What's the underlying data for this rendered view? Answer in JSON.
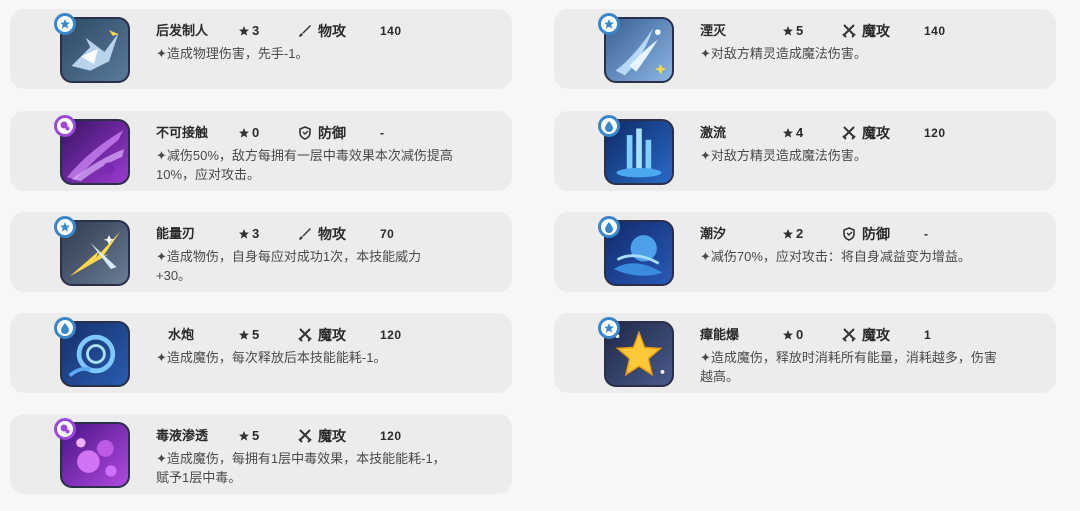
{
  "skills": [
    {
      "name": "后发制人",
      "cost": "3",
      "category": "物攻",
      "power": "140",
      "desc": "✦造成物理伤害，先手-1。",
      "element": "normal",
      "category_icon": "sword-icon",
      "tile_color": "#4a6a88"
    },
    {
      "name": "湮灭",
      "cost": "5",
      "category": "魔攻",
      "power": "140",
      "desc": "✦对敌方精灵造成魔法伤害。",
      "element": "normal",
      "category_icon": "crossed-swords-icon",
      "tile_color": "#5a7fb0"
    },
    {
      "name": "不可接触",
      "cost": "0",
      "category": "防御",
      "power": "-",
      "desc": "✦减伤50%，敌方每拥有一层中毒效果本次减伤提高10%，应对攻击。",
      "element": "poison",
      "category_icon": "shield-icon",
      "tile_color": "#6a2aa0"
    },
    {
      "name": "激流",
      "cost": "4",
      "category": "魔攻",
      "power": "120",
      "desc": "✦对敌方精灵造成魔法伤害。",
      "element": "water",
      "category_icon": "crossed-swords-icon",
      "tile_color": "#1a3f8a"
    },
    {
      "name": "能量刃",
      "cost": "3",
      "category": "物攻",
      "power": "70",
      "desc": "✦造成物伤，自身每应对成功1次，本技能威力+30。",
      "element": "normal",
      "category_icon": "sword-icon",
      "tile_color": "#4d5c70"
    },
    {
      "name": "潮汐",
      "cost": "2",
      "category": "防御",
      "power": "-",
      "desc": "✦减伤70%，应对攻击：将自身减益变为增益。",
      "element": "water",
      "category_icon": "shield-icon",
      "tile_color": "#1a3c86"
    },
    {
      "name": "水炮",
      "cost": "5",
      "category": "魔攻",
      "power": "120",
      "desc": "✦造成魔伤，每次释放后本技能能耗-1。",
      "element": "water",
      "category_icon": "crossed-swords-icon",
      "tile_color": "#1f3f80"
    },
    {
      "name": "瘴能爆",
      "cost": "0",
      "category": "魔攻",
      "power": "1",
      "desc": "✦造成魔伤，释放时消耗所有能量，消耗越多，伤害越高。",
      "element": "normal",
      "category_icon": "crossed-swords-icon",
      "tile_color": "#33406a"
    },
    {
      "name": "毒液渗透",
      "cost": "5",
      "category": "魔攻",
      "power": "120",
      "desc": "✦造成魔伤，每拥有1层中毒效果，本技能能耗-1，赋予1层中毒。",
      "element": "poison",
      "category_icon": "crossed-swords-icon",
      "tile_color": "#7a2ab0"
    }
  ],
  "colors": {
    "normal": "#3a86c8",
    "water": "#3a86c8",
    "poison": "#9a4ad8"
  }
}
